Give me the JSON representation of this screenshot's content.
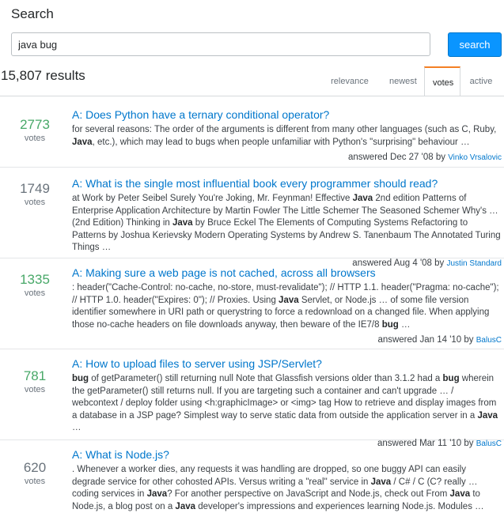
{
  "page": {
    "title": "Search"
  },
  "search": {
    "value": "java bug",
    "button_label": "search"
  },
  "results_count": "15,807 results",
  "sort_tabs": [
    {
      "label": "relevance",
      "active": false
    },
    {
      "label": "newest",
      "active": false
    },
    {
      "label": "votes",
      "active": true
    },
    {
      "label": "active",
      "active": false
    }
  ],
  "colors": {
    "accent": "#0a95ff",
    "link": "#0077cc",
    "accepted_votes": "#48a868",
    "active_tab": "#f48024"
  },
  "results": [
    {
      "votes": "2773",
      "votes_label": "votes",
      "accepted": true,
      "title": "A: Does Python have a ternary conditional operator?",
      "excerpt": [
        {
          "t": "for several reasons: The order of the arguments is different from many other languages (such as C, Ruby, "
        },
        {
          "t": "Java",
          "b": true
        },
        {
          "t": ", etc.), which may lead to bugs when people unfamiliar with Python's \"surprising\" behaviour …"
        }
      ],
      "meta": "answered Dec 27 '08 by",
      "user": "Vinko Vrsalovic"
    },
    {
      "votes": "1749",
      "votes_label": "votes",
      "accepted": false,
      "title": "A: What is the single most influential book every programmer should read?",
      "excerpt": [
        {
          "t": "at Work by Peter Seibel Surely You're Joking, Mr. Feynman! Effective "
        },
        {
          "t": "Java",
          "b": true
        },
        {
          "t": " 2nd edition Patterns of Enterprise Application Architecture by Martin Fowler The Little Schemer The Seasoned Schemer Why's … (2nd Edition) Thinking in "
        },
        {
          "t": "Java",
          "b": true
        },
        {
          "t": " by Bruce Eckel The Elements of Computing Systems Refactoring to Patterns by Joshua Kerievsky Modern Operating Systems by Andrew S. Tanenbaum The Annotated Turing Things …"
        }
      ],
      "meta": "answered Aug 4 '08 by",
      "user": "Justin Standard"
    },
    {
      "votes": "1335",
      "votes_label": "votes",
      "accepted": true,
      "title": "A: Making sure a web page is not cached, across all browsers",
      "excerpt": [
        {
          "t": ": header(\"Cache-Control: no-cache, no-store, must-revalidate\"); // HTTP 1.1. header(\"Pragma: no-cache\"); // HTTP 1.0. header(\"Expires: 0\"); // Proxies. Using "
        },
        {
          "t": "Java",
          "b": true
        },
        {
          "t": " Servlet, or Node.js … of some file version identifier somewhere in URI path or querystring to force a redownload on a changed file. When applying those no-cache headers on file downloads anyway, then beware of the IE7/8 "
        },
        {
          "t": "bug",
          "b": true
        },
        {
          "t": " …"
        }
      ],
      "meta": "answered Jan 14 '10 by",
      "user": "BalusC"
    },
    {
      "votes": "781",
      "votes_label": "votes",
      "accepted": true,
      "title": "A: How to upload files to server using JSP/Servlet?",
      "excerpt": [
        {
          "t": "bug",
          "b": true
        },
        {
          "t": " of getParameter() still returning null Note that Glassfish versions older than 3.1.2 had a "
        },
        {
          "t": "bug",
          "b": true
        },
        {
          "t": " wherein the getParameter() still returns null. If you are targeting such a container and can't upgrade … / webcontext / deploy folder using <h:graphicImage> or <img> tag How to retrieve and display images from a database in a JSP page? Simplest way to serve static data from outside the application server in a "
        },
        {
          "t": "Java",
          "b": true
        },
        {
          "t": " …"
        }
      ],
      "meta": "answered Mar 11 '10 by",
      "user": "BalusC"
    },
    {
      "votes": "620",
      "votes_label": "votes",
      "accepted": false,
      "title": "A: What is Node.js?",
      "excerpt": [
        {
          "t": ". Whenever a worker dies, any requests it was handling are dropped, so one buggy API can easily degrade service for other cohosted APIs. Versus writing a \"real\" service in "
        },
        {
          "t": "Java",
          "b": true
        },
        {
          "t": " / C# / C (C? really … coding services in "
        },
        {
          "t": "Java",
          "b": true
        },
        {
          "t": "? For another perspective on JavaScript and Node.js, check out From "
        },
        {
          "t": "Java",
          "b": true
        },
        {
          "t": " to Node.js, a blog post on a "
        },
        {
          "t": "Java",
          "b": true
        },
        {
          "t": " developer's impressions and experiences learning Node.js. Modules …"
        }
      ],
      "meta": "",
      "user": ""
    }
  ]
}
